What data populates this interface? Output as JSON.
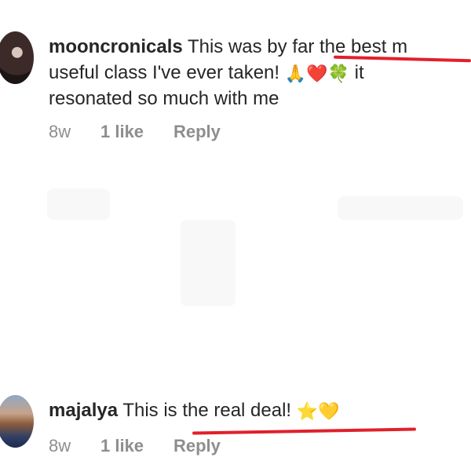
{
  "comments": [
    {
      "username": "mooncronicals",
      "lines": [
        "This was by far the best m",
        "useful class I've ever taken!",
        "it",
        "resonated so much with me"
      ],
      "emojis": [
        "🙏",
        "❤️",
        "🍀"
      ],
      "age": "8w",
      "likes": "1 like",
      "reply": "Reply"
    },
    {
      "username": "majalya",
      "text": "This is the real deal!",
      "emojis": [
        "⭐",
        "💛"
      ],
      "age": "8w",
      "likes": "1 like",
      "reply": "Reply"
    }
  ],
  "colors": {
    "text": "#262626",
    "meta": "#8e8e8e",
    "annotation": "#e0202b"
  }
}
